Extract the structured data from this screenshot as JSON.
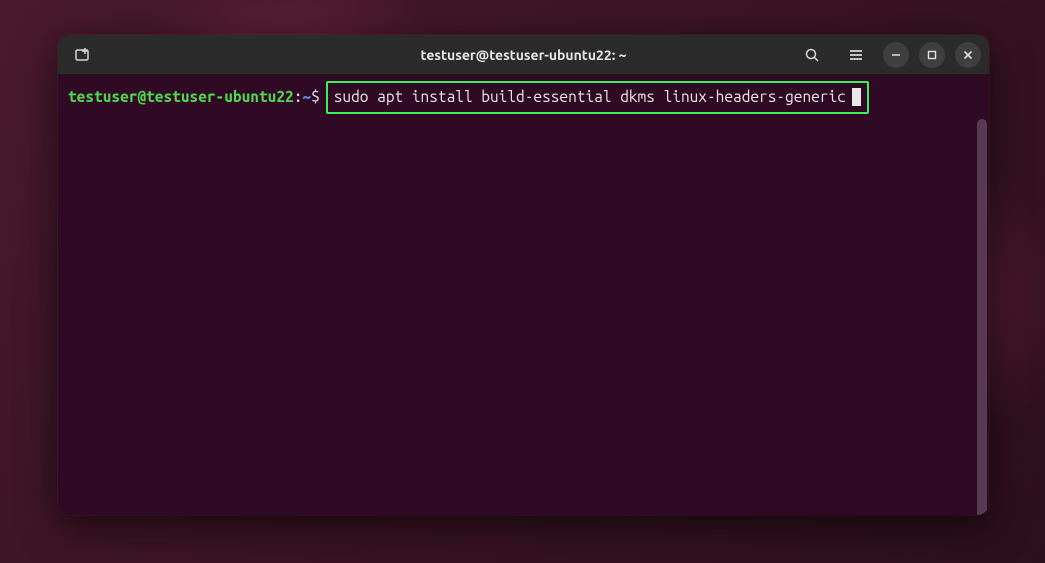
{
  "window": {
    "title": "testuser@testuser-ubuntu22: ~"
  },
  "prompt": {
    "user_host": "testuser@testuser-ubuntu22",
    "separator": ":",
    "path": "~",
    "symbol": "$"
  },
  "command": {
    "text": "sudo apt install build-essential dkms linux-headers-generic"
  }
}
